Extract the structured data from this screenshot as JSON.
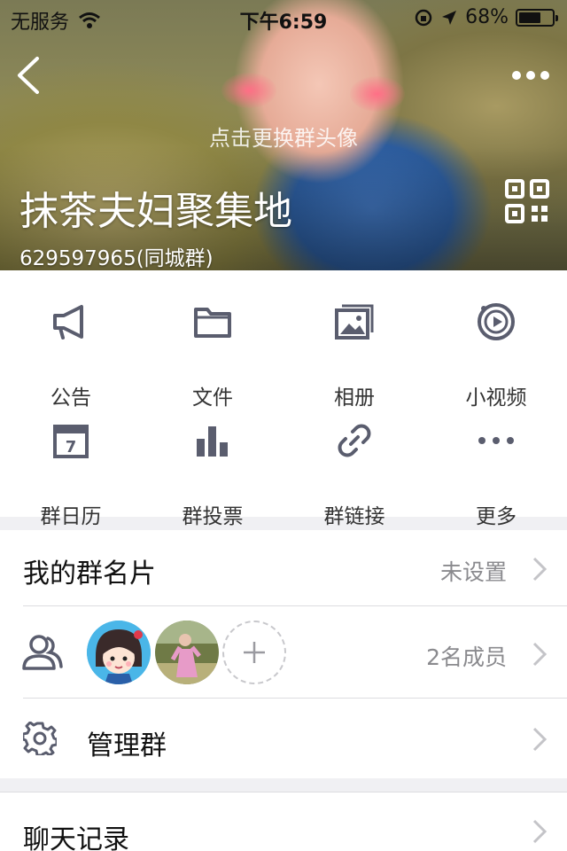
{
  "status_bar": {
    "carrier": "无服务",
    "time": "下午6:59",
    "battery_percent": "68%",
    "battery_level": 0.68
  },
  "header": {
    "change_avatar_hint": "点击更换群头像",
    "group_name": "抹茶夫妇聚集地",
    "group_sub": "629597965(同城群)"
  },
  "features": [
    {
      "label": "公告",
      "icon": "megaphone-icon"
    },
    {
      "label": "文件",
      "icon": "folder-icon"
    },
    {
      "label": "相册",
      "icon": "photo-album-icon"
    },
    {
      "label": "小视频",
      "icon": "video-icon"
    },
    {
      "label": "群日历",
      "icon": "calendar-icon"
    },
    {
      "label": "群投票",
      "icon": "vote-chart-icon"
    },
    {
      "label": "群链接",
      "icon": "link-icon"
    },
    {
      "label": "更多",
      "icon": "more-dots-icon"
    }
  ],
  "calendar_day": "7",
  "list": {
    "card_label": "我的群名片",
    "card_value": "未设置",
    "members_value": "2名成员",
    "manage_label": "管理群",
    "chat_history_label": "聊天记录"
  },
  "colors": {
    "icon": "#5a5d6e",
    "chevron": "#c4c4c8",
    "secondary_text": "#8a8a8e"
  }
}
